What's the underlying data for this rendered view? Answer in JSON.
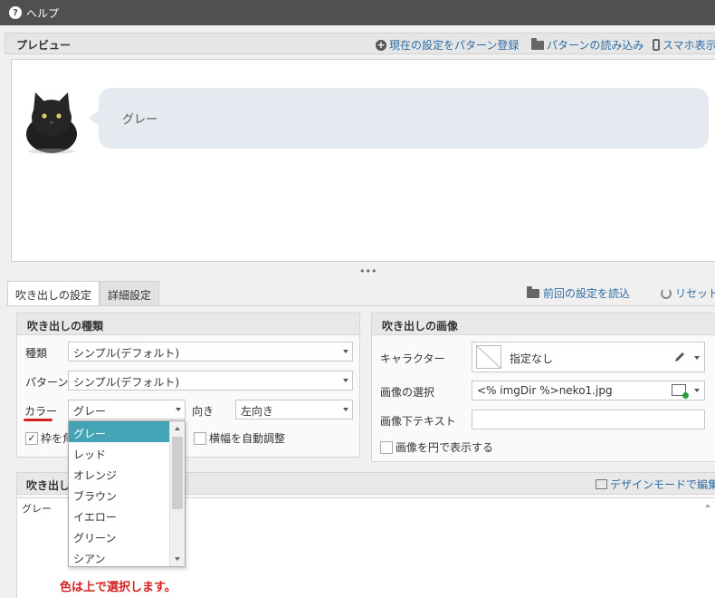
{
  "window": {
    "title": "ヘルプ"
  },
  "preview": {
    "title": "プレビュー",
    "actions": {
      "save_pattern": "現在の設定をパターン登録",
      "load_pattern": "パターンの読み込み",
      "mobile": "スマホ表示"
    },
    "bubble_text": "グレー"
  },
  "tabs": [
    {
      "label": "吹き出しの設定"
    },
    {
      "label": "詳細設定"
    }
  ],
  "top_actions": {
    "load_previous": "前回の設定を読込",
    "reset": "リセット"
  },
  "type_panel": {
    "title": "吹き出しの種類",
    "type_label": "種類",
    "type_value": "シンプル(デフォルト)",
    "pattern_label": "パターン",
    "pattern_value": "シンプル(デフォルト)",
    "color_label": "カラー",
    "color_value": "グレー",
    "direction_label": "向き",
    "direction_value": "左向き",
    "border_check": "枠を角",
    "auto_width": "横幅を自動調整"
  },
  "image_panel": {
    "title": "吹き出しの画像",
    "character_label": "キャラクター",
    "character_value": "指定なし",
    "image_select_label": "画像の選択",
    "image_value": "<% imgDir %>neko1.jpg",
    "caption_label": "画像下テキスト",
    "circle_label": "画像を円で表示する"
  },
  "body_panel": {
    "title": "吹き出しの",
    "design_mode": "デザインモードで編集",
    "content": "グレー"
  },
  "color_dropdown": {
    "options": [
      "グレー",
      "レッド",
      "オレンジ",
      "ブラウン",
      "イエロー",
      "グリーン",
      "シアン"
    ],
    "selected_index": 0
  },
  "annotation": "色は上で選択します。",
  "colors": {
    "link": "#2e6da4",
    "selected_option": "#45a3b6",
    "annotation": "#d62020",
    "bubble": "#e5e9f0"
  }
}
